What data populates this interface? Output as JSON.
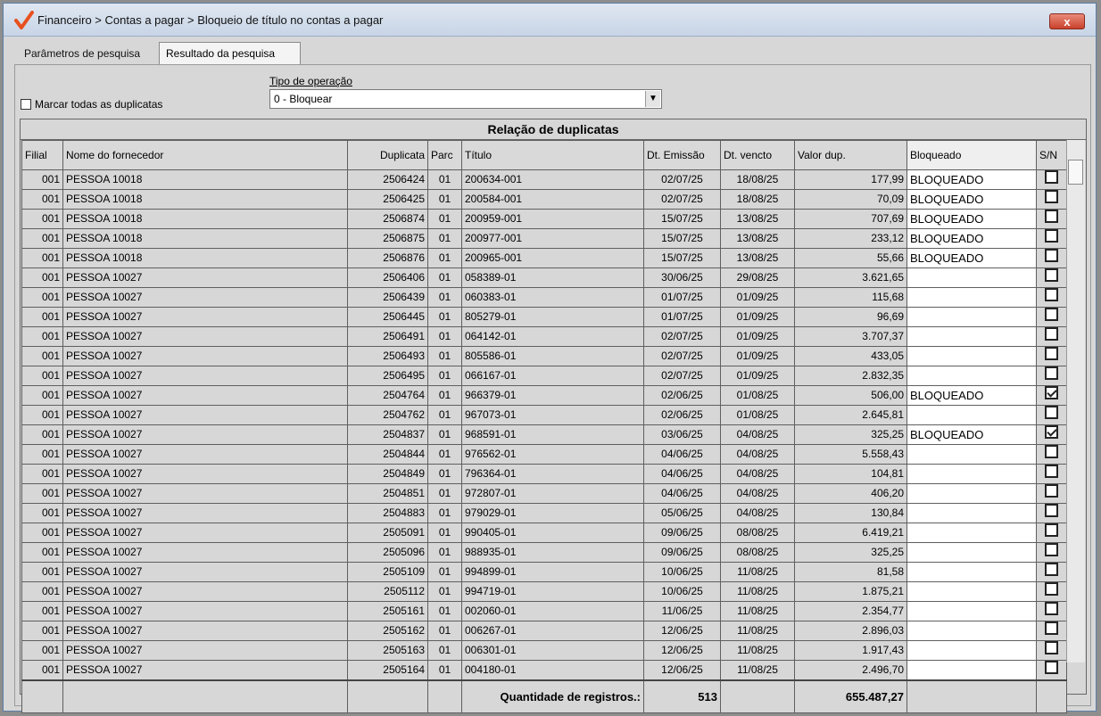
{
  "window": {
    "title": "Financeiro > Contas a pagar > Bloqueio de título no contas a pagar",
    "close_label": "x"
  },
  "tabs": [
    {
      "label": "Parâmetros de pesquisa",
      "active": false
    },
    {
      "label": "Resultado da pesquisa",
      "active": true
    }
  ],
  "mark_all": {
    "label": "Marcar todas as duplicatas",
    "checked": false
  },
  "operation": {
    "label": "Tipo de operação",
    "selected": "0 - Bloquear"
  },
  "grid": {
    "title": "Relação de duplicatas",
    "columns": [
      "Filial",
      "Nome do fornecedor",
      "Duplicata",
      "Parc",
      "Título",
      "Dt. Emissão",
      "Dt. vencto",
      "Valor dup.",
      "Bloqueado",
      "S/N"
    ],
    "rows": [
      {
        "filial": "001",
        "fornecedor": "PESSOA 10018",
        "duplicata": "2506424",
        "parc": "01",
        "titulo": "200634-001",
        "emissao": "02/07/25",
        "vencto": "18/08/25",
        "valor": "177,99",
        "bloqueado": "BLOQUEADO",
        "sn": false
      },
      {
        "filial": "001",
        "fornecedor": "PESSOA 10018",
        "duplicata": "2506425",
        "parc": "01",
        "titulo": "200584-001",
        "emissao": "02/07/25",
        "vencto": "18/08/25",
        "valor": "70,09",
        "bloqueado": "BLOQUEADO",
        "sn": false
      },
      {
        "filial": "001",
        "fornecedor": "PESSOA 10018",
        "duplicata": "2506874",
        "parc": "01",
        "titulo": "200959-001",
        "emissao": "15/07/25",
        "vencto": "13/08/25",
        "valor": "707,69",
        "bloqueado": "BLOQUEADO",
        "sn": false
      },
      {
        "filial": "001",
        "fornecedor": "PESSOA 10018",
        "duplicata": "2506875",
        "parc": "01",
        "titulo": "200977-001",
        "emissao": "15/07/25",
        "vencto": "13/08/25",
        "valor": "233,12",
        "bloqueado": "BLOQUEADO",
        "sn": false
      },
      {
        "filial": "001",
        "fornecedor": "PESSOA 10018",
        "duplicata": "2506876",
        "parc": "01",
        "titulo": "200965-001",
        "emissao": "15/07/25",
        "vencto": "13/08/25",
        "valor": "55,66",
        "bloqueado": "BLOQUEADO",
        "sn": false
      },
      {
        "filial": "001",
        "fornecedor": "PESSOA 10027",
        "duplicata": "2506406",
        "parc": "01",
        "titulo": "058389-01",
        "emissao": "30/06/25",
        "vencto": "29/08/25",
        "valor": "3.621,65",
        "bloqueado": "",
        "sn": false
      },
      {
        "filial": "001",
        "fornecedor": "PESSOA 10027",
        "duplicata": "2506439",
        "parc": "01",
        "titulo": "060383-01",
        "emissao": "01/07/25",
        "vencto": "01/09/25",
        "valor": "115,68",
        "bloqueado": "",
        "sn": false
      },
      {
        "filial": "001",
        "fornecedor": "PESSOA 10027",
        "duplicata": "2506445",
        "parc": "01",
        "titulo": "805279-01",
        "emissao": "01/07/25",
        "vencto": "01/09/25",
        "valor": "96,69",
        "bloqueado": "",
        "sn": false
      },
      {
        "filial": "001",
        "fornecedor": "PESSOA 10027",
        "duplicata": "2506491",
        "parc": "01",
        "titulo": "064142-01",
        "emissao": "02/07/25",
        "vencto": "01/09/25",
        "valor": "3.707,37",
        "bloqueado": "",
        "sn": false
      },
      {
        "filial": "001",
        "fornecedor": "PESSOA 10027",
        "duplicata": "2506493",
        "parc": "01",
        "titulo": "805586-01",
        "emissao": "02/07/25",
        "vencto": "01/09/25",
        "valor": "433,05",
        "bloqueado": "",
        "sn": false
      },
      {
        "filial": "001",
        "fornecedor": "PESSOA 10027",
        "duplicata": "2506495",
        "parc": "01",
        "titulo": "066167-01",
        "emissao": "02/07/25",
        "vencto": "01/09/25",
        "valor": "2.832,35",
        "bloqueado": "",
        "sn": false
      },
      {
        "filial": "001",
        "fornecedor": "PESSOA 10027",
        "duplicata": "2504764",
        "parc": "01",
        "titulo": "966379-01",
        "emissao": "02/06/25",
        "vencto": "01/08/25",
        "valor": "506,00",
        "bloqueado": "BLOQUEADO",
        "sn": true
      },
      {
        "filial": "001",
        "fornecedor": "PESSOA 10027",
        "duplicata": "2504762",
        "parc": "01",
        "titulo": "967073-01",
        "emissao": "02/06/25",
        "vencto": "01/08/25",
        "valor": "2.645,81",
        "bloqueado": "",
        "sn": false
      },
      {
        "filial": "001",
        "fornecedor": "PESSOA 10027",
        "duplicata": "2504837",
        "parc": "01",
        "titulo": "968591-01",
        "emissao": "03/06/25",
        "vencto": "04/08/25",
        "valor": "325,25",
        "bloqueado": "BLOQUEADO",
        "sn": true
      },
      {
        "filial": "001",
        "fornecedor": "PESSOA 10027",
        "duplicata": "2504844",
        "parc": "01",
        "titulo": "976562-01",
        "emissao": "04/06/25",
        "vencto": "04/08/25",
        "valor": "5.558,43",
        "bloqueado": "",
        "sn": false
      },
      {
        "filial": "001",
        "fornecedor": "PESSOA 10027",
        "duplicata": "2504849",
        "parc": "01",
        "titulo": "796364-01",
        "emissao": "04/06/25",
        "vencto": "04/08/25",
        "valor": "104,81",
        "bloqueado": "",
        "sn": false
      },
      {
        "filial": "001",
        "fornecedor": "PESSOA 10027",
        "duplicata": "2504851",
        "parc": "01",
        "titulo": "972807-01",
        "emissao": "04/06/25",
        "vencto": "04/08/25",
        "valor": "406,20",
        "bloqueado": "",
        "sn": false
      },
      {
        "filial": "001",
        "fornecedor": "PESSOA 10027",
        "duplicata": "2504883",
        "parc": "01",
        "titulo": "979029-01",
        "emissao": "05/06/25",
        "vencto": "04/08/25",
        "valor": "130,84",
        "bloqueado": "",
        "sn": false
      },
      {
        "filial": "001",
        "fornecedor": "PESSOA 10027",
        "duplicata": "2505091",
        "parc": "01",
        "titulo": "990405-01",
        "emissao": "09/06/25",
        "vencto": "08/08/25",
        "valor": "6.419,21",
        "bloqueado": "",
        "sn": false
      },
      {
        "filial": "001",
        "fornecedor": "PESSOA 10027",
        "duplicata": "2505096",
        "parc": "01",
        "titulo": "988935-01",
        "emissao": "09/06/25",
        "vencto": "08/08/25",
        "valor": "325,25",
        "bloqueado": "",
        "sn": false
      },
      {
        "filial": "001",
        "fornecedor": "PESSOA 10027",
        "duplicata": "2505109",
        "parc": "01",
        "titulo": "994899-01",
        "emissao": "10/06/25",
        "vencto": "11/08/25",
        "valor": "81,58",
        "bloqueado": "",
        "sn": false
      },
      {
        "filial": "001",
        "fornecedor": "PESSOA 10027",
        "duplicata": "2505112",
        "parc": "01",
        "titulo": "994719-01",
        "emissao": "10/06/25",
        "vencto": "11/08/25",
        "valor": "1.875,21",
        "bloqueado": "",
        "sn": false
      },
      {
        "filial": "001",
        "fornecedor": "PESSOA 10027",
        "duplicata": "2505161",
        "parc": "01",
        "titulo": "002060-01",
        "emissao": "11/06/25",
        "vencto": "11/08/25",
        "valor": "2.354,77",
        "bloqueado": "",
        "sn": false
      },
      {
        "filial": "001",
        "fornecedor": "PESSOA 10027",
        "duplicata": "2505162",
        "parc": "01",
        "titulo": "006267-01",
        "emissao": "12/06/25",
        "vencto": "11/08/25",
        "valor": "2.896,03",
        "bloqueado": "",
        "sn": false
      },
      {
        "filial": "001",
        "fornecedor": "PESSOA 10027",
        "duplicata": "2505163",
        "parc": "01",
        "titulo": "006301-01",
        "emissao": "12/06/25",
        "vencto": "11/08/25",
        "valor": "1.917,43",
        "bloqueado": "",
        "sn": false
      },
      {
        "filial": "001",
        "fornecedor": "PESSOA 10027",
        "duplicata": "2505164",
        "parc": "01",
        "titulo": "004180-01",
        "emissao": "12/06/25",
        "vencto": "11/08/25",
        "valor": "2.496,70",
        "bloqueado": "",
        "sn": false
      }
    ],
    "footer": {
      "label": "Quantidade de registros.:",
      "count": "513",
      "total": "655.487,27"
    }
  },
  "colors": {
    "accent_logo": "#e8511f",
    "titlebar": "#c8d5e6",
    "close_button": "#c9422c"
  }
}
